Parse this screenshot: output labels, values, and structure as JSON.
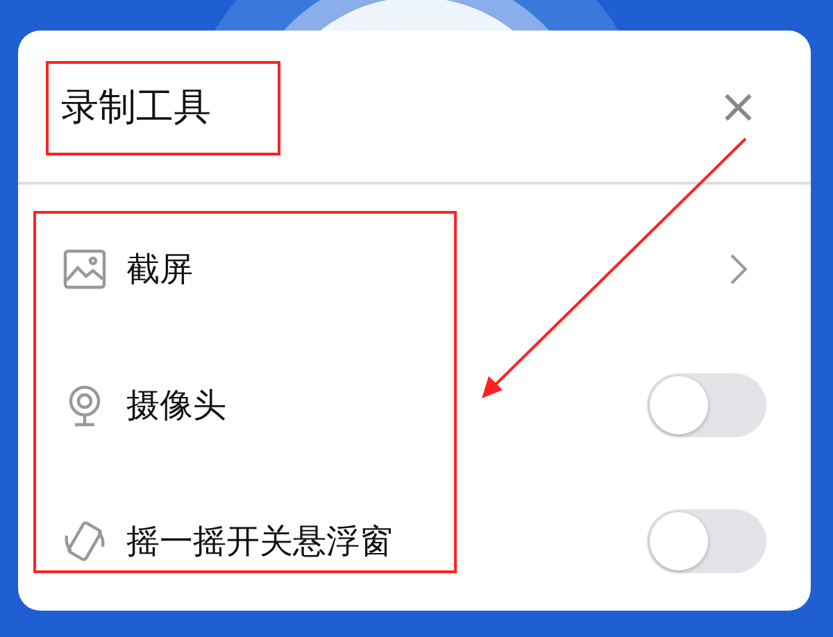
{
  "dialog": {
    "title": "录制工具",
    "close_label": "×"
  },
  "items": [
    {
      "kind": "link",
      "label": "截屏"
    },
    {
      "kind": "toggle",
      "label": "摄像头",
      "on": false
    },
    {
      "kind": "toggle",
      "label": "摇一摇开关悬浮窗",
      "on": false
    }
  ]
}
